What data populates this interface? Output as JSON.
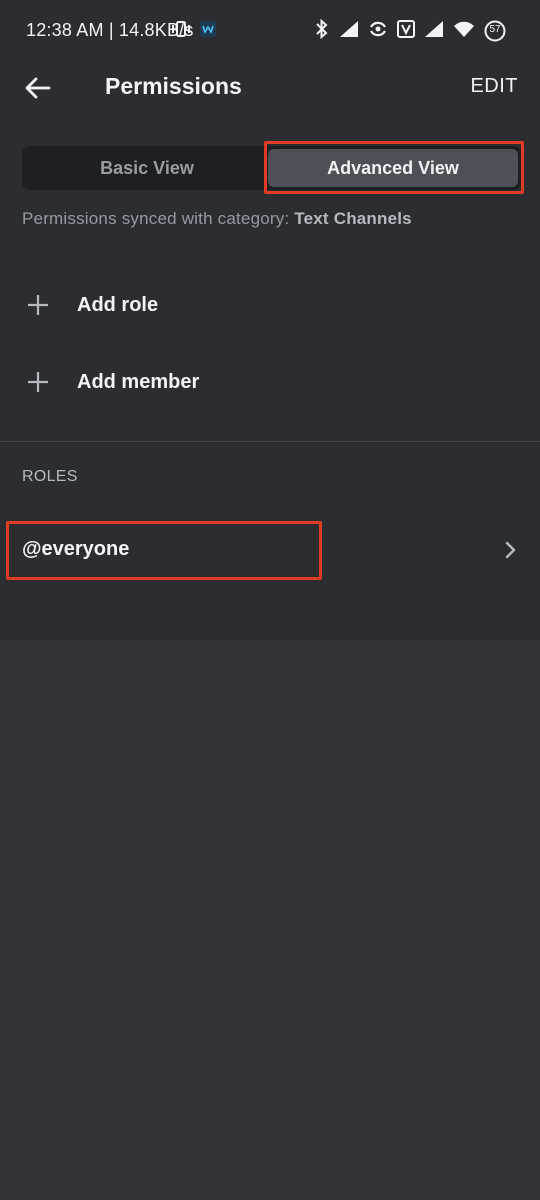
{
  "status_bar": {
    "time": "12:38 AM | 14.8KB/s",
    "battery": "57",
    "icons": [
      "vibrate-icon",
      "app-notification-icon",
      "bluetooth-icon",
      "signal-icon",
      "hotspot-icon",
      "volte-icon",
      "signal-icon-2",
      "wifi-icon",
      "battery-icon"
    ]
  },
  "header": {
    "back_icon": "back-arrow-icon",
    "title": "Permissions",
    "edit_label": "EDIT"
  },
  "view_toggle": {
    "basic_label": "Basic View",
    "advanced_label": "Advanced View",
    "selected": "Advanced View"
  },
  "sync_note": {
    "prefix": "Permissions synced with category: ",
    "category": "Text Channels"
  },
  "actions": {
    "add_role_label": "Add role",
    "add_member_label": "Add member"
  },
  "roles": {
    "header": "ROLES",
    "items": [
      {
        "name": "@everyone"
      }
    ]
  },
  "colors": {
    "background": "#313338",
    "panel": "#2b2d31",
    "highlight": "#e03c24",
    "selected_segment": "#4e5058"
  }
}
